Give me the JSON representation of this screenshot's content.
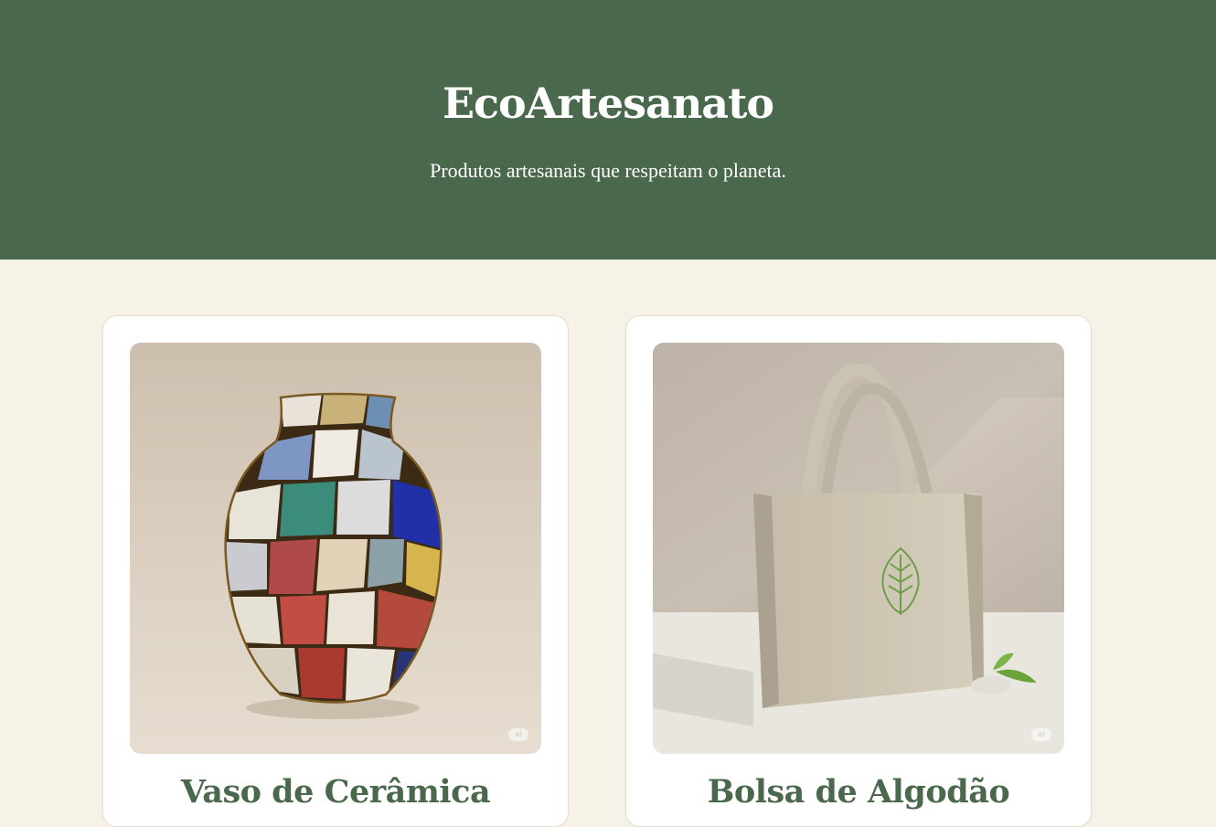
{
  "header": {
    "title": "EcoArtesanato",
    "tagline": "Produtos artesanais que respeitam o planeta."
  },
  "products": [
    {
      "name": "Vaso de Cerâmica",
      "image_icon": "mosaic-vase-image",
      "badge": "ai"
    },
    {
      "name": "Bolsa de Algodão",
      "image_icon": "cotton-tote-bag-image",
      "badge": "ai"
    }
  ],
  "colors": {
    "header_bg": "#4a684c",
    "page_bg": "#f6f2e7",
    "card_bg": "#ffffff",
    "accent": "#4a684c"
  }
}
